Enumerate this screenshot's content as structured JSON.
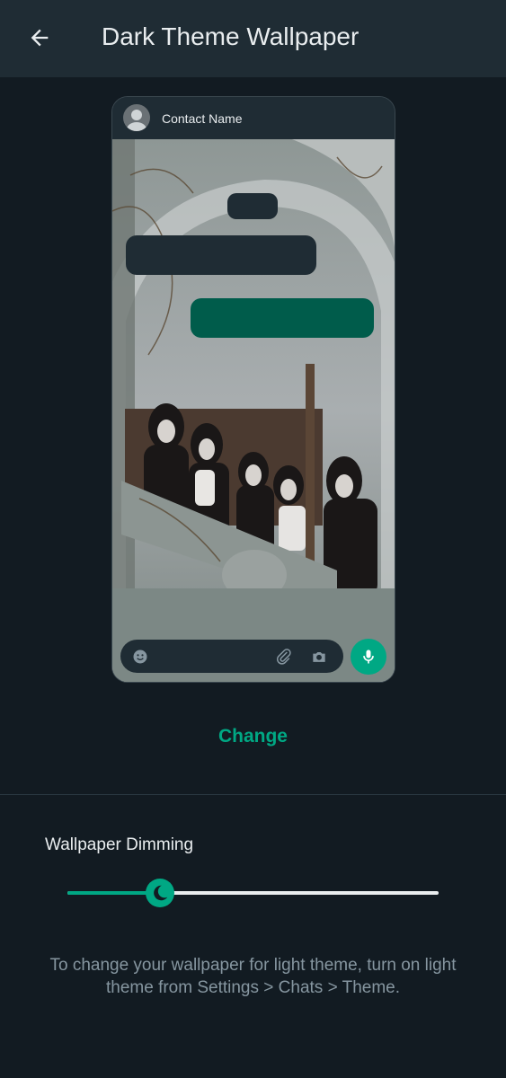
{
  "header": {
    "title": "Dark Theme Wallpaper",
    "back_icon": "arrow-back-icon"
  },
  "preview": {
    "contact_name": "Contact Name",
    "avatar_icon": "person-avatar-icon",
    "composer_icons": [
      "emoji-icon",
      "attach-icon",
      "camera-icon"
    ],
    "mic_icon": "mic-icon",
    "wallpaper": "photo of five women posing on a stone staircase under an arch"
  },
  "actions": {
    "change_label": "Change"
  },
  "dimming": {
    "label": "Wallpaper Dimming",
    "value": 0.25,
    "thumb_icon": "moon-icon"
  },
  "hint": "To change your wallpaper for light theme, turn on light theme from Settings > Chats > Theme.",
  "colors": {
    "accent": "#00a884",
    "background": "#121b22",
    "appbar": "#1f2c34",
    "outgoing_bubble": "#005c4b",
    "secondary_text": "#8696a0"
  }
}
